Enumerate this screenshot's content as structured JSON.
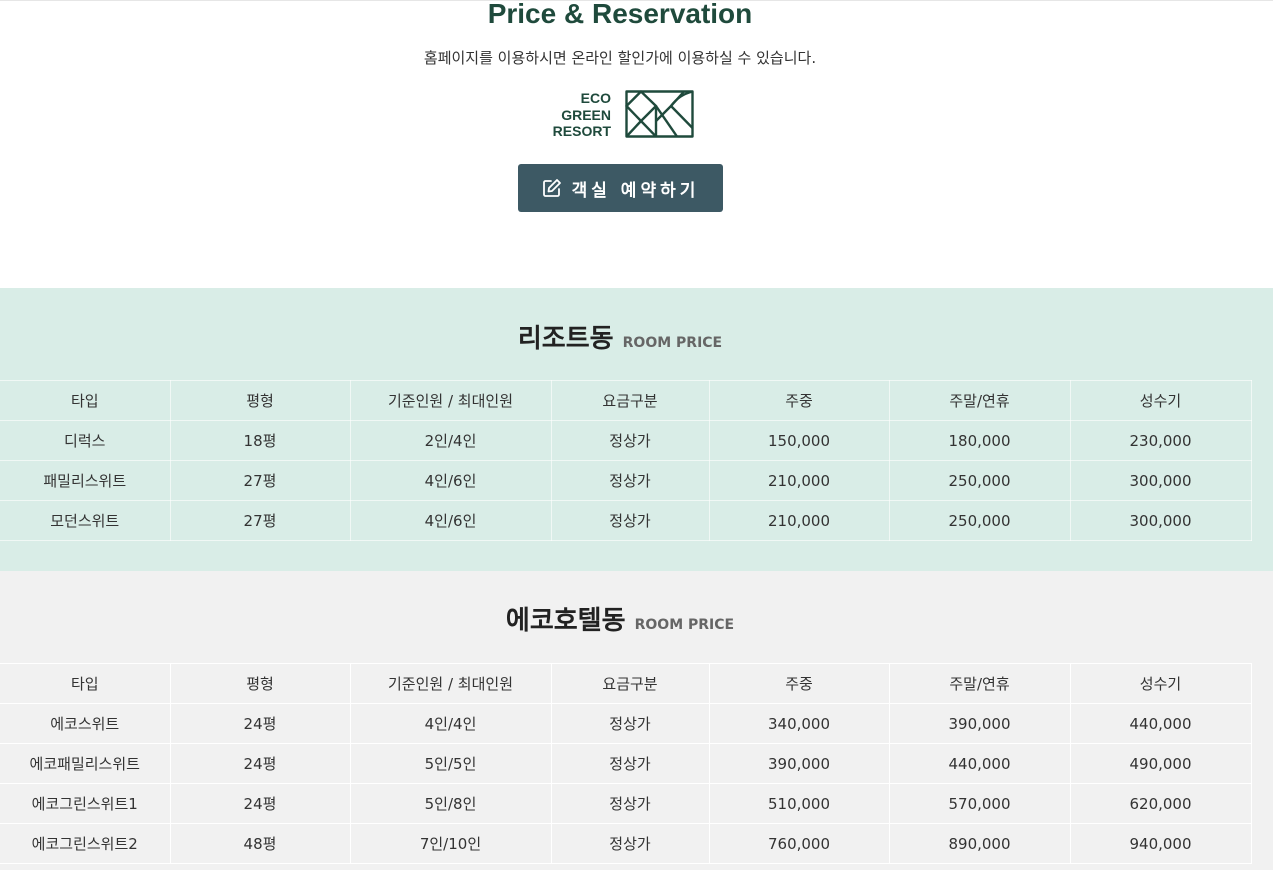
{
  "hero": {
    "title": "Price & Reservation",
    "subtitle": "홈페이지를 이용하시면 온라인 할인가에 이용하실 수 있습니다.",
    "logo_text": [
      "ECO",
      "GREEN",
      "RESORT"
    ],
    "reserve_button": "객실 예약하기",
    "brand_color": "#1f4a3c",
    "button_color": "#3d5964"
  },
  "sections": [
    {
      "title": "리조트동",
      "subtitle": "ROOM PRICE",
      "background": "#d9ede7",
      "columns": [
        "타입",
        "평형",
        "기준인원 / 최대인원",
        "요금구분",
        "주중",
        "주말/연휴",
        "성수기"
      ],
      "rows": [
        [
          "디럭스",
          "18평",
          "2인/4인",
          "정상가",
          "150,000",
          "180,000",
          "230,000"
        ],
        [
          "패밀리스위트",
          "27평",
          "4인/6인",
          "정상가",
          "210,000",
          "250,000",
          "300,000"
        ],
        [
          "모던스위트",
          "27평",
          "4인/6인",
          "정상가",
          "210,000",
          "250,000",
          "300,000"
        ]
      ]
    },
    {
      "title": "에코호텔동",
      "subtitle": "ROOM PRICE",
      "background": "#f1f1f1",
      "columns": [
        "타입",
        "평형",
        "기준인원 / 최대인원",
        "요금구분",
        "주중",
        "주말/연휴",
        "성수기"
      ],
      "rows": [
        [
          "에코스위트",
          "24평",
          "4인/4인",
          "정상가",
          "340,000",
          "390,000",
          "440,000"
        ],
        [
          "에코패밀리스위트",
          "24평",
          "5인/5인",
          "정상가",
          "390,000",
          "440,000",
          "490,000"
        ],
        [
          "에코그린스위트1",
          "24평",
          "5인/8인",
          "정상가",
          "510,000",
          "570,000",
          "620,000"
        ],
        [
          "에코그린스위트2",
          "48평",
          "7인/10인",
          "정상가",
          "760,000",
          "890,000",
          "940,000"
        ]
      ]
    }
  ]
}
